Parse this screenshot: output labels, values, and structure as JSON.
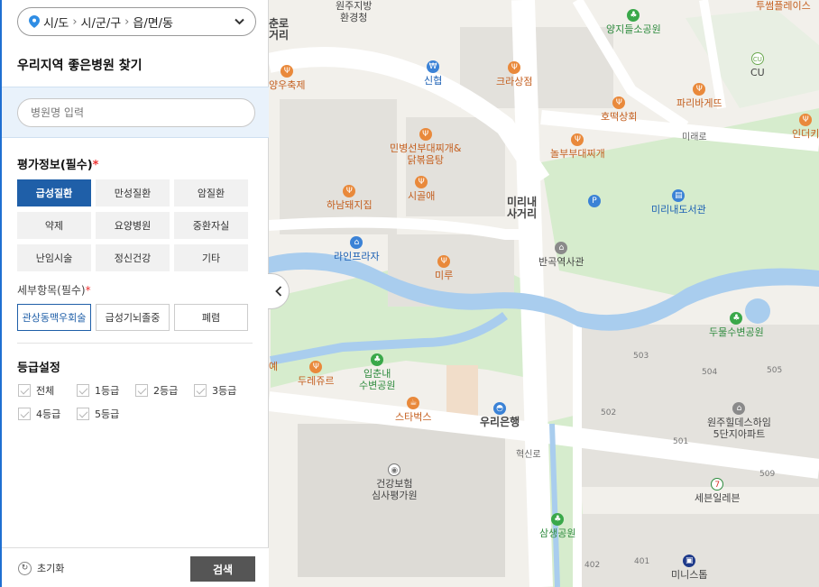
{
  "location": {
    "sido": "시/도",
    "sigungu": "시/군/구",
    "eupmyeondong": "읍/면/동"
  },
  "panel_title": "우리지역 좋은병원 찾기",
  "search": {
    "placeholder": "병원명 입력"
  },
  "evaluation": {
    "heading": "평가정보(필수)",
    "required_mark": "*",
    "buttons": [
      "급성질환",
      "만성질환",
      "암질환",
      "약제",
      "요양병원",
      "중환자실",
      "난임시술",
      "정신건강",
      "기타"
    ],
    "active": "급성질환"
  },
  "detail": {
    "heading": "세부항목(필수)",
    "required_mark": "*",
    "buttons": [
      "관상동맥우회술",
      "급성기뇌졸중",
      "폐렴"
    ],
    "active": "관상동맥우회술"
  },
  "grade": {
    "heading": "등급설정",
    "options": [
      "전체",
      "1등급",
      "2등급",
      "3등급",
      "4등급",
      "5등급"
    ]
  },
  "footer": {
    "reset_label": "초기화",
    "search_label": "검색"
  },
  "map": {
    "pois": {
      "wonju_env": "원주지방\n환경청",
      "chunro": "춘로\n거리",
      "yangji": "양지들소공원",
      "tusum": "투썸플레이스",
      "cu": "CU",
      "sinhyeop": "신협",
      "krasang": "크라상점",
      "paris": "파리바게뜨",
      "indeo": "인더키",
      "yangchuk": "양우축제",
      "hotteok": "호떡상회",
      "mire_ro": "미래로",
      "minbyeong": "민병선부대찌개&\n닭볶음탕",
      "nolbu": "놀부부대찌개",
      "hanam": "하남돼지집",
      "sigol": "시골애",
      "mirinae_crossroad": "미리내\n사거리",
      "mirinae_lib": "미리내도서관",
      "line_plaza": "라인프라자",
      "miru": "미루",
      "bangok": "반곡역사관",
      "dumul": "두물수변공원",
      "jeon": "예",
      "durejuru": "두레쥬르",
      "ipchunnae": "입춘내\n수변공원",
      "starbucks": "스타벅스",
      "woori": "우리은행",
      "hyeoksin": "혁신로",
      "wonju_hill": "원주힐데스하임\n5단지아파트",
      "health": "건강보험\n심사평가원",
      "seven": "세븐일레븐",
      "samsaeng": "삼생공원",
      "ministop": "미니스톱"
    },
    "apartments": [
      "503",
      "504",
      "505",
      "502",
      "501",
      "509",
      "402",
      "401"
    ]
  }
}
